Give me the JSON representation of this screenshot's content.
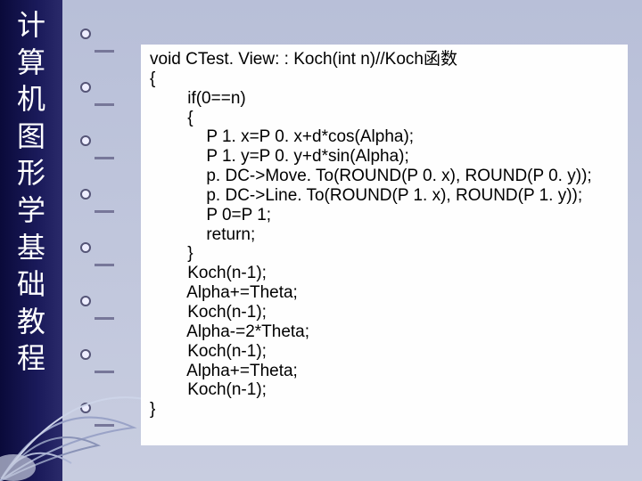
{
  "banner": {
    "chars": [
      "计",
      "算",
      "机",
      "图",
      "形",
      "学",
      "基",
      "础",
      "教",
      "程"
    ]
  },
  "code": {
    "lines": [
      "void CTest. View: : Koch(int n)//Koch函数",
      "{",
      "        if(0==n)",
      "        {",
      "            P 1. x=P 0. x+d*cos(Alpha);",
      "            P 1. y=P 0. y+d*sin(Alpha);",
      "            p. DC->Move. To(ROUND(P 0. x), ROUND(P 0. y));",
      "            p. DC->Line. To(ROUND(P 1. x), ROUND(P 1. y));",
      "            P 0=P 1;",
      "            return;",
      "        }",
      "        Koch(n-1);",
      "        Alpha+=Theta;",
      "        Koch(n-1);",
      "        Alpha-=2*Theta;",
      "        Koch(n-1);",
      "        Alpha+=Theta;",
      "        Koch(n-1);",
      "}"
    ]
  }
}
